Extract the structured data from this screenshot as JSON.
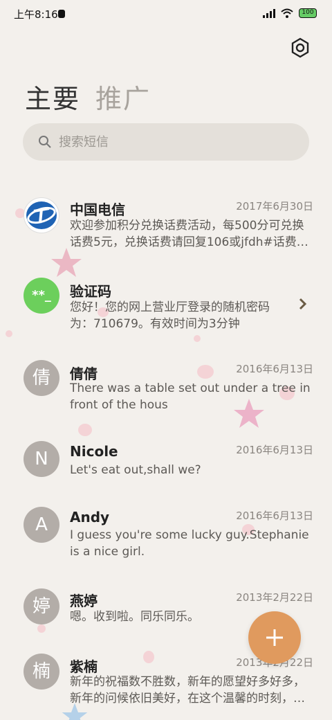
{
  "status_bar": {
    "time": "上午8:16",
    "battery": "100"
  },
  "tabs": [
    {
      "label": "主要",
      "active": true
    },
    {
      "label": "推广",
      "active": false
    }
  ],
  "search": {
    "placeholder": "搜索短信"
  },
  "messages": [
    {
      "name": "中国电信",
      "date": "2017年6月30日",
      "preview": "欢迎参加积分兑换话费活动，每500分可兑换话费5元，兑换话费请回复106或jfdh#话费…",
      "avatar": "telecom-logo"
    },
    {
      "name": "验证码",
      "date": "",
      "preview": "您好！您的网上营业厅登录的随机密码为：710679。有效时间为3分钟",
      "avatar_text": "**_",
      "avatar_color": "#6ccf5c"
    },
    {
      "name": "倩倩",
      "date": "2016年6月13日",
      "preview": "There was a table set out under a tree in front of the hous",
      "avatar_text": "倩"
    },
    {
      "name": "Nicole",
      "date": "2016年6月13日",
      "preview": "Let's eat out,shall we?",
      "avatar_text": "N"
    },
    {
      "name": "Andy",
      "date": "2016年6月13日",
      "preview": "I guess you're some lucky guy.Stephanie is a nice girl.",
      "avatar_text": "A"
    },
    {
      "name": "燕婷",
      "date": "2013年2月22日",
      "preview": "嗯。收到啦。同乐同乐。",
      "avatar_text": "婷"
    },
    {
      "name": "紫楠",
      "date": "2013年2月22日",
      "preview": "新年的祝福数不胜数，新年的愿望好多好多，新年的问候依旧美好，在这个温馨的时刻，…",
      "avatar_text": "楠"
    }
  ],
  "colors": {
    "background": "#f3f0ec",
    "accent_fab": "#e09a5e",
    "avatar_gray": "#b3ada8",
    "verify_green": "#6ccf5c"
  },
  "icons": [
    "settings-icon",
    "search-icon",
    "chevron-right-icon",
    "plus-icon",
    "telecom-logo-icon"
  ]
}
